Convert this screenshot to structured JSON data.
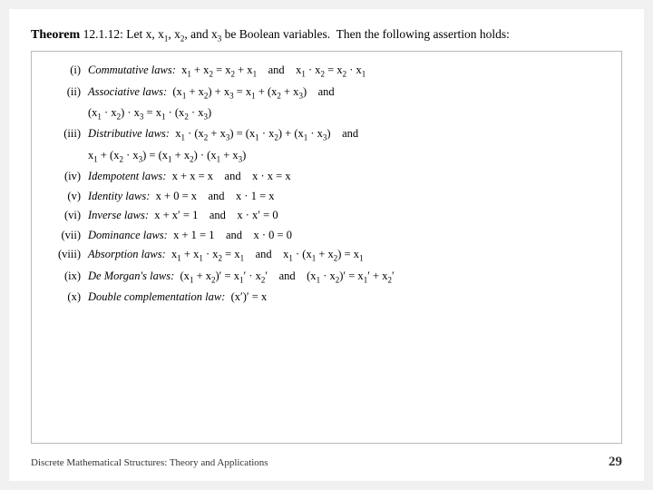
{
  "page": {
    "theorem_word": "Theorem",
    "theorem_ref": "12.1.12:",
    "theorem_intro": "Let x, x₁, x₂, and x₃ be Boolean variables. Then the following assertion holds:",
    "footer_left": "Discrete Mathematical Structures: Theory and Applications",
    "footer_page": "29"
  }
}
